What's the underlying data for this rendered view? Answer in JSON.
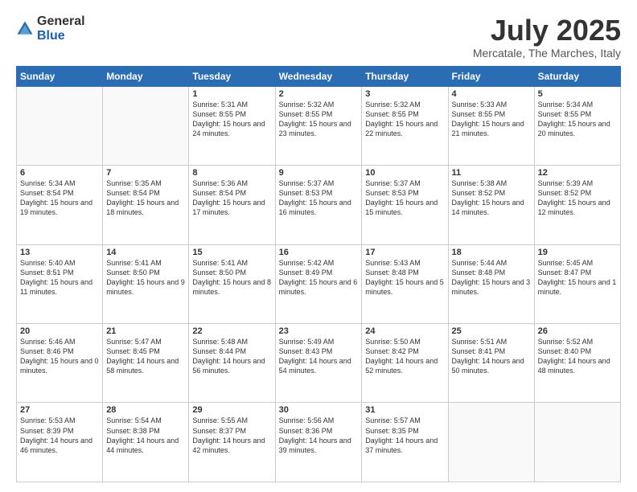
{
  "logo": {
    "general": "General",
    "blue": "Blue"
  },
  "header": {
    "month": "July 2025",
    "location": "Mercatale, The Marches, Italy"
  },
  "weekdays": [
    "Sunday",
    "Monday",
    "Tuesday",
    "Wednesday",
    "Thursday",
    "Friday",
    "Saturday"
  ],
  "weeks": [
    [
      {
        "day": "",
        "info": ""
      },
      {
        "day": "",
        "info": ""
      },
      {
        "day": "1",
        "info": "Sunrise: 5:31 AM\nSunset: 8:55 PM\nDaylight: 15 hours\nand 24 minutes."
      },
      {
        "day": "2",
        "info": "Sunrise: 5:32 AM\nSunset: 8:55 PM\nDaylight: 15 hours\nand 23 minutes."
      },
      {
        "day": "3",
        "info": "Sunrise: 5:32 AM\nSunset: 8:55 PM\nDaylight: 15 hours\nand 22 minutes."
      },
      {
        "day": "4",
        "info": "Sunrise: 5:33 AM\nSunset: 8:55 PM\nDaylight: 15 hours\nand 21 minutes."
      },
      {
        "day": "5",
        "info": "Sunrise: 5:34 AM\nSunset: 8:55 PM\nDaylight: 15 hours\nand 20 minutes."
      }
    ],
    [
      {
        "day": "6",
        "info": "Sunrise: 5:34 AM\nSunset: 8:54 PM\nDaylight: 15 hours\nand 19 minutes."
      },
      {
        "day": "7",
        "info": "Sunrise: 5:35 AM\nSunset: 8:54 PM\nDaylight: 15 hours\nand 18 minutes."
      },
      {
        "day": "8",
        "info": "Sunrise: 5:36 AM\nSunset: 8:54 PM\nDaylight: 15 hours\nand 17 minutes."
      },
      {
        "day": "9",
        "info": "Sunrise: 5:37 AM\nSunset: 8:53 PM\nDaylight: 15 hours\nand 16 minutes."
      },
      {
        "day": "10",
        "info": "Sunrise: 5:37 AM\nSunset: 8:53 PM\nDaylight: 15 hours\nand 15 minutes."
      },
      {
        "day": "11",
        "info": "Sunrise: 5:38 AM\nSunset: 8:52 PM\nDaylight: 15 hours\nand 14 minutes."
      },
      {
        "day": "12",
        "info": "Sunrise: 5:39 AM\nSunset: 8:52 PM\nDaylight: 15 hours\nand 12 minutes."
      }
    ],
    [
      {
        "day": "13",
        "info": "Sunrise: 5:40 AM\nSunset: 8:51 PM\nDaylight: 15 hours\nand 11 minutes."
      },
      {
        "day": "14",
        "info": "Sunrise: 5:41 AM\nSunset: 8:50 PM\nDaylight: 15 hours\nand 9 minutes."
      },
      {
        "day": "15",
        "info": "Sunrise: 5:41 AM\nSunset: 8:50 PM\nDaylight: 15 hours\nand 8 minutes."
      },
      {
        "day": "16",
        "info": "Sunrise: 5:42 AM\nSunset: 8:49 PM\nDaylight: 15 hours\nand 6 minutes."
      },
      {
        "day": "17",
        "info": "Sunrise: 5:43 AM\nSunset: 8:48 PM\nDaylight: 15 hours\nand 5 minutes."
      },
      {
        "day": "18",
        "info": "Sunrise: 5:44 AM\nSunset: 8:48 PM\nDaylight: 15 hours\nand 3 minutes."
      },
      {
        "day": "19",
        "info": "Sunrise: 5:45 AM\nSunset: 8:47 PM\nDaylight: 15 hours\nand 1 minute."
      }
    ],
    [
      {
        "day": "20",
        "info": "Sunrise: 5:46 AM\nSunset: 8:46 PM\nDaylight: 15 hours\nand 0 minutes."
      },
      {
        "day": "21",
        "info": "Sunrise: 5:47 AM\nSunset: 8:45 PM\nDaylight: 14 hours\nand 58 minutes."
      },
      {
        "day": "22",
        "info": "Sunrise: 5:48 AM\nSunset: 8:44 PM\nDaylight: 14 hours\nand 56 minutes."
      },
      {
        "day": "23",
        "info": "Sunrise: 5:49 AM\nSunset: 8:43 PM\nDaylight: 14 hours\nand 54 minutes."
      },
      {
        "day": "24",
        "info": "Sunrise: 5:50 AM\nSunset: 8:42 PM\nDaylight: 14 hours\nand 52 minutes."
      },
      {
        "day": "25",
        "info": "Sunrise: 5:51 AM\nSunset: 8:41 PM\nDaylight: 14 hours\nand 50 minutes."
      },
      {
        "day": "26",
        "info": "Sunrise: 5:52 AM\nSunset: 8:40 PM\nDaylight: 14 hours\nand 48 minutes."
      }
    ],
    [
      {
        "day": "27",
        "info": "Sunrise: 5:53 AM\nSunset: 8:39 PM\nDaylight: 14 hours\nand 46 minutes."
      },
      {
        "day": "28",
        "info": "Sunrise: 5:54 AM\nSunset: 8:38 PM\nDaylight: 14 hours\nand 44 minutes."
      },
      {
        "day": "29",
        "info": "Sunrise: 5:55 AM\nSunset: 8:37 PM\nDaylight: 14 hours\nand 42 minutes."
      },
      {
        "day": "30",
        "info": "Sunrise: 5:56 AM\nSunset: 8:36 PM\nDaylight: 14 hours\nand 39 minutes."
      },
      {
        "day": "31",
        "info": "Sunrise: 5:57 AM\nSunset: 8:35 PM\nDaylight: 14 hours\nand 37 minutes."
      },
      {
        "day": "",
        "info": ""
      },
      {
        "day": "",
        "info": ""
      }
    ]
  ]
}
